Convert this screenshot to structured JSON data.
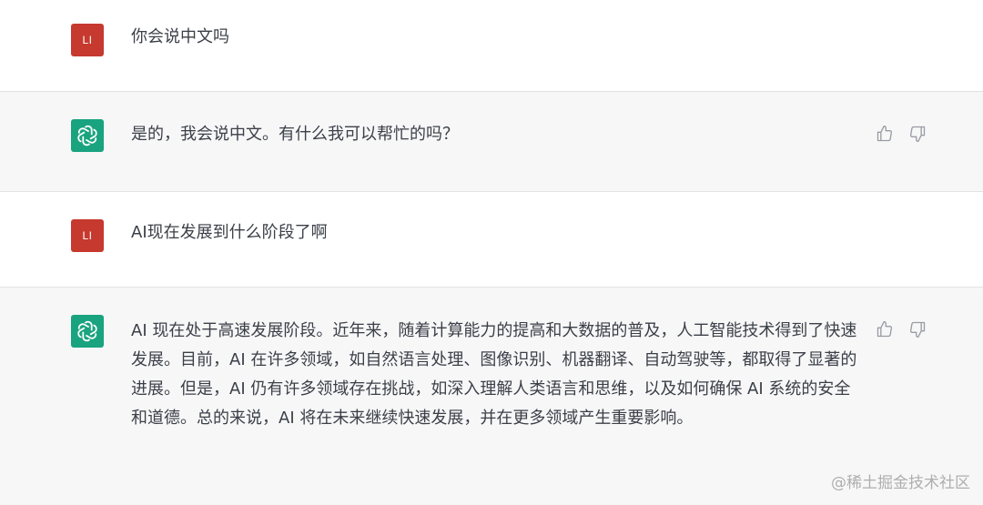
{
  "conversation": [
    {
      "role": "user",
      "avatar_text": "LI",
      "text": "你会说中文吗"
    },
    {
      "role": "assistant",
      "avatar_icon": "openai-logo-icon",
      "text": "是的，我会说中文。有什么我可以帮忙的吗？",
      "actions": [
        "thumbs-up-icon",
        "thumbs-down-icon"
      ]
    },
    {
      "role": "user",
      "avatar_text": "LI",
      "text": "AI现在发展到什么阶段了啊"
    },
    {
      "role": "assistant",
      "avatar_icon": "openai-logo-icon",
      "text": "AI 现在处于高速发展阶段。近年来，随着计算能力的提高和大数据的普及，人工智能技术得到了快速发展。目前，AI 在许多领域，如自然语言处理、图像识别、机器翻译、自动驾驶等，都取得了显著的进展。但是，AI 仍有许多领域存在挑战，如深入理解人类语言和思维，以及如何确保 AI 系统的安全和道德。总的来说，AI 将在未来继续快速发展，并在更多领域产生重要影响。",
      "actions": [
        "thumbs-up-icon",
        "thumbs-down-icon"
      ]
    }
  ],
  "watermark": "@稀土掘金技术社区",
  "colors": {
    "user_avatar": "#c6392e",
    "assistant_avatar": "#19a37f",
    "assistant_row_bg": "#f7f7f8"
  }
}
